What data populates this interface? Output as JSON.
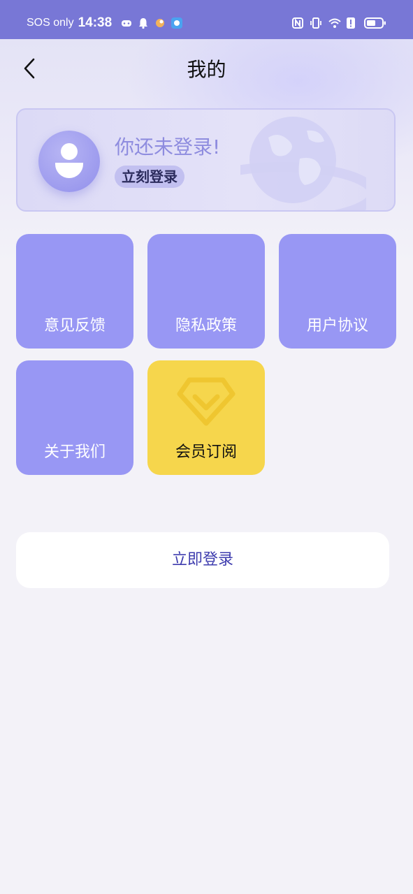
{
  "status_bar": {
    "carrier": "SOS only",
    "time": "14:38",
    "left_icons": [
      "game-controller-icon",
      "bell-icon",
      "app-notification-icon",
      "app-badge-icon"
    ],
    "right_icons": [
      "nfc-icon",
      "vibrate-icon",
      "wifi-icon",
      "data-alert-icon",
      "battery-icon"
    ]
  },
  "header": {
    "title": "我的",
    "back_icon": "chevron-left-icon"
  },
  "profile": {
    "prompt": "你还未登录!",
    "login_chip": "立刻登录",
    "avatar_icon": "user-avatar-icon"
  },
  "menu": {
    "items": [
      {
        "label": "意见反馈"
      },
      {
        "label": "隐私政策"
      },
      {
        "label": "用户协议"
      },
      {
        "label": "关于我们"
      },
      {
        "label": "会员订阅",
        "icon": "diamond-icon"
      }
    ]
  },
  "login_button": {
    "label": "立即登录"
  },
  "colors": {
    "status_bar": "#7877d6",
    "tile": "#9897f4",
    "vip_tile": "#f6d64c",
    "accent_text": "#3e3cae",
    "background": "#f3f2f8"
  }
}
